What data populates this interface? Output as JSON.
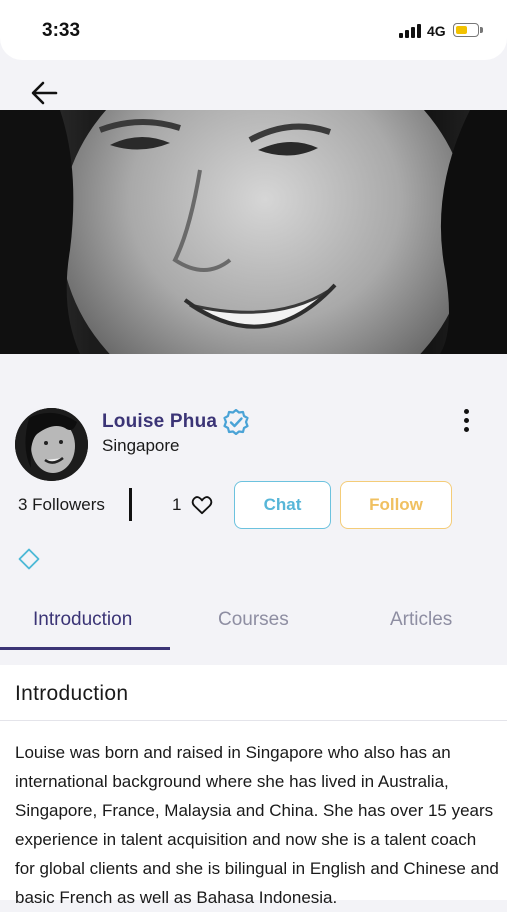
{
  "status_bar": {
    "time": "3:33",
    "network": "4G",
    "battery_level": 0.6
  },
  "profile": {
    "name": "Louise Phua",
    "location": "Singapore",
    "verified": true,
    "followers_text": "3 Followers",
    "likes_count": "1",
    "chat_label": "Chat",
    "follow_label": "Follow"
  },
  "tabs": [
    {
      "label": "Introduction",
      "active": true
    },
    {
      "label": "Courses",
      "active": false
    },
    {
      "label": "Articles",
      "active": false
    }
  ],
  "introduction": {
    "title": "Introduction",
    "body": "Louise was born and raised in Singapore who also has an international background where she has lived in Australia, Singapore, France, Malaysia and China.  She has over 15 years experience in talent acquisition and now she is a talent coach for global clients and she is bilingual in English and Chinese and basic French as well as Bahasa Indonesia."
  },
  "colors": {
    "primary": "#3b3476",
    "chat": "#57b6d8",
    "follow": "#f0c060",
    "badge": "#4aa3d6"
  },
  "icons": [
    "back-arrow-icon",
    "verified-badge-icon",
    "more-vertical-icon",
    "heart-icon",
    "diamond-icon",
    "signal-icon",
    "battery-icon"
  ]
}
